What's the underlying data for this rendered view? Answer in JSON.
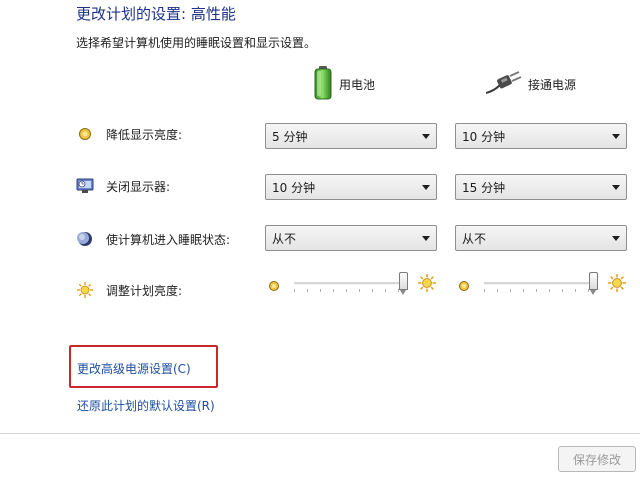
{
  "title": "更改计划的设置: 高性能",
  "subtitle": "选择希望计算机使用的睡眠设置和显示设置。",
  "columns": {
    "battery": "用电池",
    "plugged_in": "接通电源"
  },
  "rows": {
    "dim_display": {
      "label": "降低显示亮度:",
      "battery_value": "5 分钟",
      "plugged_value": "10 分钟"
    },
    "turn_off_display": {
      "label": "关闭显示器:",
      "battery_value": "10 分钟",
      "plugged_value": "15 分钟"
    },
    "sleep": {
      "label": "使计算机进入睡眠状态:",
      "battery_value": "从不",
      "plugged_value": "从不"
    },
    "brightness": {
      "label": "调整计划亮度:",
      "battery_level": 1.0,
      "plugged_level": 1.0
    }
  },
  "links": {
    "advanced": "更改高级电源设置(C)",
    "restore": "还原此计划的默认设置(R)"
  },
  "buttons": {
    "save": "保存修改"
  },
  "colors": {
    "title": "#1e3287",
    "link": "#1e4ea0",
    "highlight_border": "#c8282d",
    "battery_green": "#3aa82c"
  }
}
